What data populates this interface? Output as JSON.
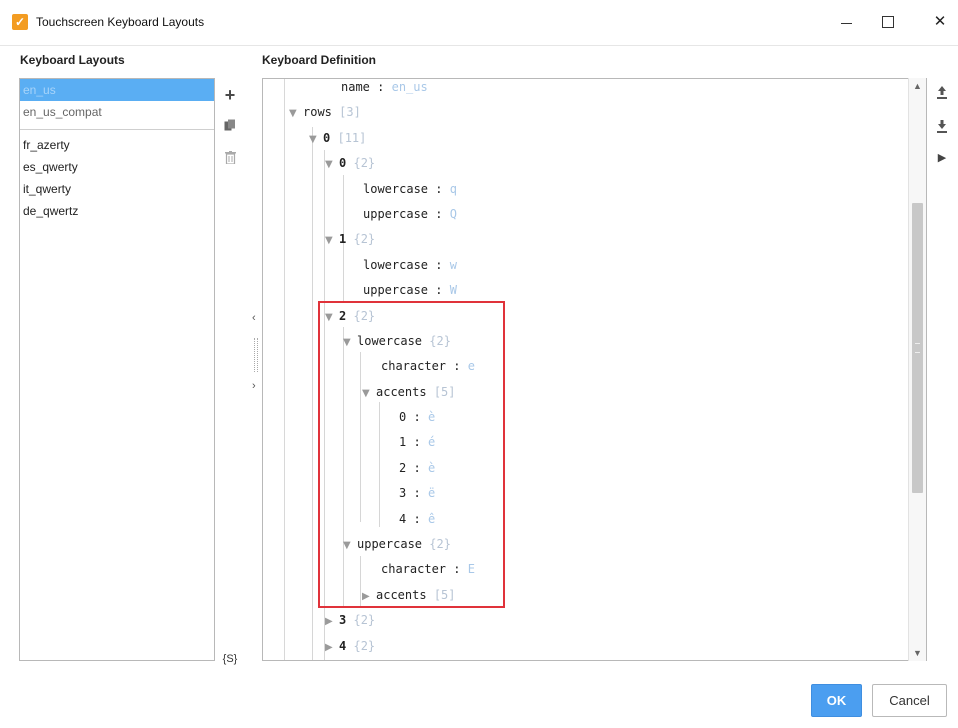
{
  "window": {
    "title": "Touchscreen Keyboard Layouts",
    "app_icon": "check-icon"
  },
  "sections": {
    "layouts_header": "Keyboard Layouts",
    "definition_header": "Keyboard Definition"
  },
  "layouts": {
    "items_primary": [
      "en_us",
      "en_us_compat"
    ],
    "items_secondary": [
      "fr_azerty",
      "es_qwerty",
      "it_qwerty",
      "de_qwertz"
    ],
    "selected": "en_us"
  },
  "toolbar": {
    "add_icon": "plus-icon",
    "copy_icon": "copy-icon",
    "delete_icon": "trash-icon",
    "vars_label": "{S}"
  },
  "tree": {
    "name_key": "name",
    "name_value": "en_us",
    "rows_key": "rows",
    "rows_count": "[3]",
    "row0_key": "0",
    "row0_count": "[11]",
    "k0_key": "0",
    "k0_count": "{2}",
    "k0_lower_key": "lowercase",
    "k0_lower_val": "q",
    "k0_upper_key": "uppercase",
    "k0_upper_val": "Q",
    "k1_key": "1",
    "k1_count": "{2}",
    "k1_lower_key": "lowercase",
    "k1_lower_val": "w",
    "k1_upper_key": "uppercase",
    "k1_upper_val": "W",
    "k2_key": "2",
    "k2_count": "{2}",
    "k2_lower_key": "lowercase",
    "k2_lower_count": "{2}",
    "k2_lower_char_key": "character",
    "k2_lower_char_val": "e",
    "k2_lower_accents_key": "accents",
    "k2_lower_accents_count": "[5]",
    "accents": [
      {
        "key": "0",
        "val": "è"
      },
      {
        "key": "1",
        "val": "é"
      },
      {
        "key": "2",
        "val": "è"
      },
      {
        "key": "3",
        "val": "ë"
      },
      {
        "key": "4",
        "val": "ê"
      }
    ],
    "k2_upper_key": "uppercase",
    "k2_upper_count": "{2}",
    "k2_upper_char_key": "character",
    "k2_upper_char_val": "E",
    "k2_upper_accents_key": "accents",
    "k2_upper_accents_count": "[5]",
    "k3_key": "3",
    "k3_count": "{2}",
    "k4_key": "4",
    "k4_count": "{2}",
    "colon": ":"
  },
  "right_toolbar": {
    "export_icon": "export-icon",
    "import_icon": "import-icon",
    "play_icon": "play-icon"
  },
  "buttons": {
    "ok": "OK",
    "cancel": "Cancel"
  },
  "colors": {
    "selection": "#5aaef3",
    "ok_button": "#4b9ef0",
    "highlight": "#e0323a",
    "app_icon": "#f39c22"
  }
}
